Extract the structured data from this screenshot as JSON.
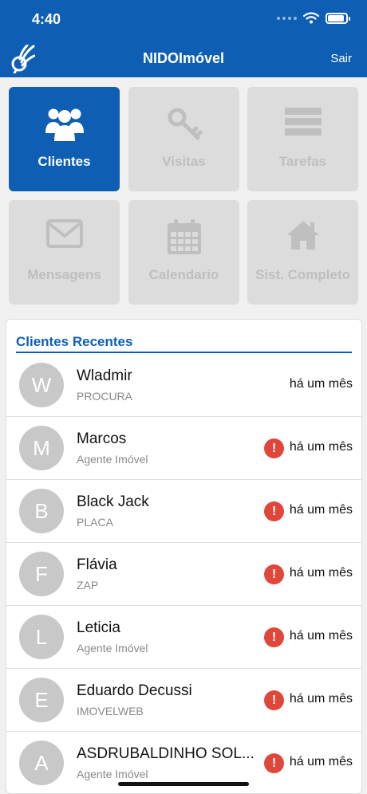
{
  "status_bar": {
    "time": "4:40"
  },
  "header": {
    "title": "NIDOImóvel",
    "logout_label": "Sair",
    "logo_icon": "bird-logo-icon"
  },
  "accent_color": "#0e5fb4",
  "alert_color": "#e0463a",
  "tiles": [
    {
      "label": "Clientes",
      "icon": "users-icon",
      "active": true
    },
    {
      "label": "Visitas",
      "icon": "key-icon",
      "active": false
    },
    {
      "label": "Tarefas",
      "icon": "list-icon",
      "active": false
    },
    {
      "label": "Mensagens",
      "icon": "mail-icon",
      "active": false
    },
    {
      "label": "Calendario",
      "icon": "calendar-icon",
      "active": false
    },
    {
      "label": "Sist. Completo",
      "icon": "home-icon",
      "active": false
    }
  ],
  "recent": {
    "title": "Clientes Recentes",
    "clients": [
      {
        "initial": "W",
        "name": "Wladmir",
        "source": "PROCURA",
        "when": "há um mês",
        "alert": false
      },
      {
        "initial": "M",
        "name": "Marcos",
        "source": "Agente Imóvel",
        "when": "há um mês",
        "alert": true
      },
      {
        "initial": "B",
        "name": "Black Jack",
        "source": "PLACA",
        "when": "há um mês",
        "alert": true
      },
      {
        "initial": "F",
        "name": "Flávia",
        "source": "ZAP",
        "when": "há um mês",
        "alert": true
      },
      {
        "initial": "L",
        "name": "Leticia",
        "source": "Agente Imóvel",
        "when": "há um mês",
        "alert": true
      },
      {
        "initial": "E",
        "name": "Eduardo Decussi",
        "source": "IMOVELWEB",
        "when": "há um mês",
        "alert": true
      },
      {
        "initial": "A",
        "name": "ASDRUBALDINHO SOL...",
        "source": "Agente Imóvel",
        "when": "há um mês",
        "alert": true
      }
    ]
  }
}
